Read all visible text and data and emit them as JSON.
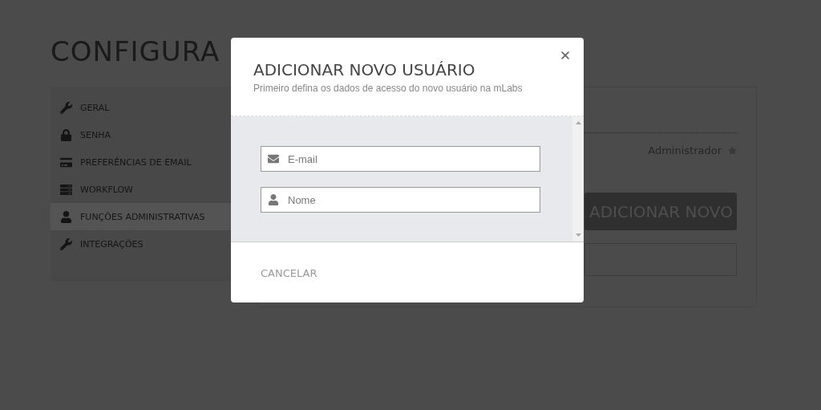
{
  "page_title": "CONFIGURA",
  "sidebar": {
    "items": [
      {
        "label": "GERAL",
        "kind": "wrench",
        "selected": false
      },
      {
        "label": "SENHA",
        "kind": "lock",
        "selected": false
      },
      {
        "label": "PREFERÊNCIAS DE EMAIL",
        "kind": "card",
        "selected": false
      },
      {
        "label": "WORKFLOW",
        "kind": "server",
        "selected": false
      },
      {
        "label": "FUNÇÕES ADMINISTRATIVAS",
        "kind": "user",
        "selected": true
      },
      {
        "label": "INTEGRAÇÕES",
        "kind": "wrench",
        "selected": false
      }
    ]
  },
  "content": {
    "role": "Administrador",
    "add_button": "ADICIONAR NOVO"
  },
  "modal": {
    "title": "ADICIONAR NOVO USUÁRIO",
    "subtitle": "Primeiro defina os dados de acesso do novo usuário na mLabs",
    "fields": [
      {
        "placeholder": "E-mail",
        "kind": "email"
      },
      {
        "placeholder": "Nome",
        "kind": "name"
      }
    ],
    "cancel_button": "CANCELAR"
  }
}
